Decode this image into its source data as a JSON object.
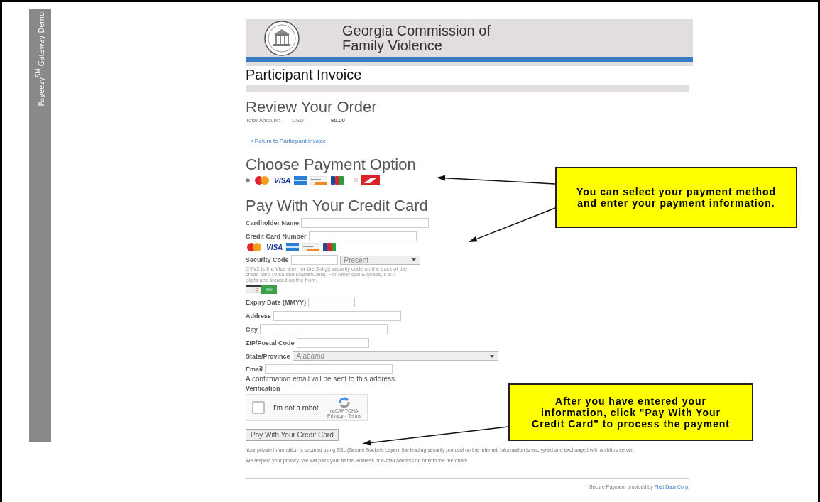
{
  "sidebar": {
    "title": "Payeezy$^{SM}$ Gateway Demo"
  },
  "header": {
    "title_lines": [
      "Georgia Commission of",
      "Family Violence"
    ]
  },
  "page_title": "Participant Invoice",
  "review": {
    "heading": "Review Your Order",
    "total_label": "Total Amount:",
    "currency": "USD",
    "amount": "60.00"
  },
  "return_link": "« Return to Participant Invoice",
  "payment_option": {
    "heading": "Choose Payment Option",
    "options": [
      {
        "kind": "cards",
        "selected": true
      },
      {
        "kind": "alternate",
        "selected": false
      }
    ],
    "cards": [
      {
        "kind": "mastercard"
      },
      {
        "kind": "visa",
        "label": "VISA"
      },
      {
        "kind": "amex"
      },
      {
        "kind": "discover"
      },
      {
        "kind": "jcb"
      }
    ]
  },
  "credit_card": {
    "heading": "Pay With Your Credit Card",
    "cards": [
      {
        "kind": "mastercard"
      },
      {
        "kind": "visa",
        "label": "VISA"
      },
      {
        "kind": "amex"
      },
      {
        "kind": "discover"
      },
      {
        "kind": "jcb"
      }
    ],
    "fields": [
      {
        "kind": "text",
        "label": "Cardholder Name"
      },
      {
        "kind": "card_number",
        "label": "Credit Card Number"
      },
      {
        "kind": "security",
        "label": "Security Code",
        "value": "Present",
        "note": "CVV2 is the Visa term for the 3-digit security code on the back of the credit card (Visa and MasterCard). For American Express, it is 4-digits and located on the front."
      },
      {
        "kind": "text",
        "label": "Expiry Date (MMYY)"
      },
      {
        "kind": "text",
        "label": "Address"
      },
      {
        "kind": "text",
        "label": "City"
      },
      {
        "kind": "text",
        "label": "ZIP/Postal Code"
      },
      {
        "kind": "select",
        "label": "State/Province",
        "value": "Alabama"
      },
      {
        "kind": "email",
        "label": "Email",
        "note": "A confirmation email will be sent to this address."
      }
    ]
  },
  "verification": {
    "label": "Verification",
    "checked": false,
    "captcha_text": "I'm not a robot",
    "brand": "reCAPTCHA",
    "links": "Privacy - Terms"
  },
  "submit": "Pay With Your Credit Card",
  "footer": {
    "security_note": "Your private information is secured using SSL (Secure Sockets Layer), the leading security protocol on the Internet. Information is encrypted and exchanged with an https server.",
    "privacy_note": "We respect your privacy. We will pass your name, address or e-mail address on only to the merchant.",
    "provided_by": "Secure Payment provided by",
    "provider_link": "First Data Corp."
  },
  "callouts": [
    {
      "text": "You can select your payment method and enter your payment information."
    },
    {
      "text": "After you have entered your information, click \"Pay With Your Credit Card\" to process the payment"
    }
  ]
}
